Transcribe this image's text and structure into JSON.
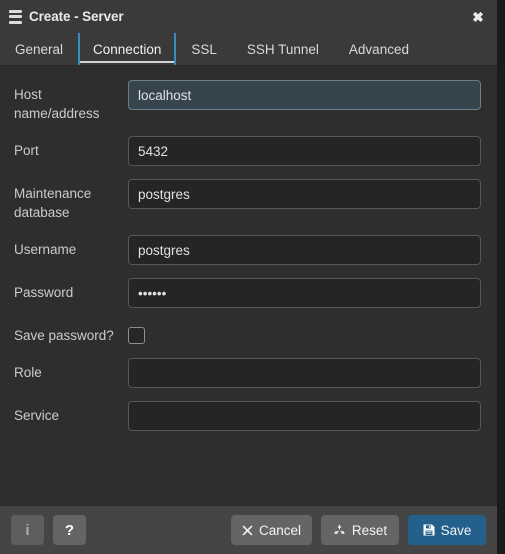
{
  "window": {
    "title": "Create - Server",
    "icon": "server-stack-icon",
    "close_label": "✖"
  },
  "tabs": [
    {
      "label": "General",
      "active": false
    },
    {
      "label": "Connection",
      "active": true
    },
    {
      "label": "SSL",
      "active": false
    },
    {
      "label": "SSH Tunnel",
      "active": false
    },
    {
      "label": "Advanced",
      "active": false
    }
  ],
  "form": {
    "fields": [
      {
        "label": "Host name/address",
        "value": "localhost",
        "placeholder": "",
        "type": "text",
        "focused": true
      },
      {
        "label": "Port",
        "value": "5432",
        "placeholder": "",
        "type": "text",
        "focused": false
      },
      {
        "label": "Maintenance database",
        "value": "postgres",
        "placeholder": "",
        "type": "text",
        "focused": false
      },
      {
        "label": "Username",
        "value": "postgres",
        "placeholder": "",
        "type": "text",
        "focused": false
      },
      {
        "label": "Password",
        "value": "••••••",
        "placeholder": "",
        "type": "password",
        "focused": false
      },
      {
        "label": "Save password?",
        "value": "",
        "placeholder": "",
        "type": "checkbox",
        "checked": false
      },
      {
        "label": "Role",
        "value": "",
        "placeholder": "",
        "type": "text",
        "focused": false
      },
      {
        "label": "Service",
        "value": "",
        "placeholder": "",
        "type": "text",
        "focused": false
      }
    ]
  },
  "footer": {
    "info_label": "i",
    "help_label": "?",
    "cancel_label": "Cancel",
    "reset_label": "Reset",
    "save_label": "Save"
  },
  "colors": {
    "accent_blue": "#3a8dbf",
    "save_blue": "#23618c",
    "dialog_bg": "#2e2e2e",
    "titlebar_bg": "#3a3a3a",
    "footer_bg": "#454545",
    "input_bg": "#252525",
    "input_focus_bg": "#36444d",
    "text": "#d6d9dc"
  }
}
